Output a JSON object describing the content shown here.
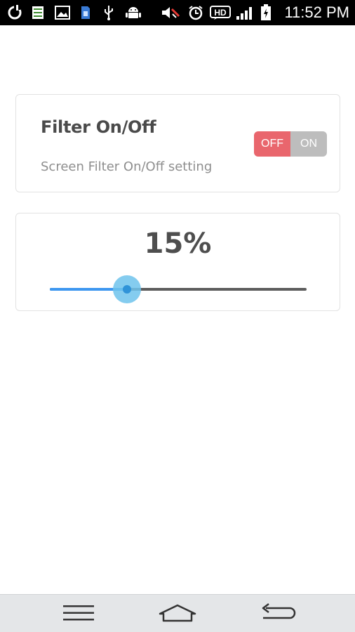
{
  "status_bar": {
    "time": "11:52 PM",
    "hd_label": "HD",
    "icons": [
      "app-logo-icon",
      "list-icon",
      "image-icon",
      "sim-card-icon",
      "usb-icon",
      "android-icon",
      "volume-muted-icon",
      "alarm-clock-icon",
      "hd-voice-icon",
      "signal-icon",
      "battery-charging-icon"
    ]
  },
  "filter_card": {
    "title": "Filter On/Off",
    "subtitle": "Screen Filter On/Off setting",
    "toggle": {
      "off_label": "OFF",
      "on_label": "ON",
      "state": "off",
      "off_color": "#e9666d",
      "on_color": "#bdbdbd"
    }
  },
  "level_card": {
    "value_text": "15%",
    "value": 0.3,
    "colors": {
      "fill": "#3d97f0",
      "track": "#5d5d5d",
      "thumb": "#6ec3ec"
    }
  },
  "nav_bar": {
    "icons": [
      "menu-icon",
      "home-icon",
      "back-icon"
    ]
  }
}
